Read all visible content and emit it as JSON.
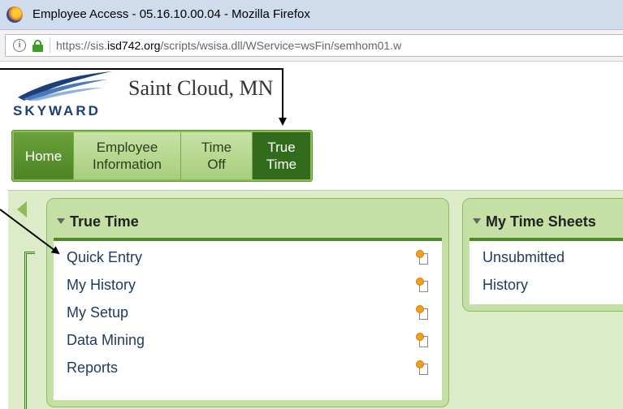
{
  "browser": {
    "title": "Employee Access - 05.16.10.00.04 - Mozilla Firefox",
    "url_prefix": "https://sis.",
    "url_domain": "isd742.org",
    "url_suffix": "/scripts/wsisa.dll/WService=wsFin/semhom01.w"
  },
  "header": {
    "logo_text": "SKYWARD",
    "district": "Saint Cloud, MN"
  },
  "nav": {
    "home": "Home",
    "employee_info_line1": "Employee",
    "employee_info_line2": "Information",
    "time_off_line1": "Time",
    "time_off_line2": "Off",
    "true_time_line1": "True",
    "true_time_line2": "Time"
  },
  "true_time_box": {
    "title": "True Time",
    "items": [
      "Quick Entry",
      "My History",
      "My Setup",
      "Data Mining",
      "Reports"
    ]
  },
  "time_sheets_box": {
    "title": "My Time Sheets",
    "items": [
      "Unsubmitted",
      "History"
    ]
  },
  "colors": {
    "nav_active": "#326b1c",
    "panel": "#c5e0a5",
    "link_text": "#1e3a5f"
  }
}
